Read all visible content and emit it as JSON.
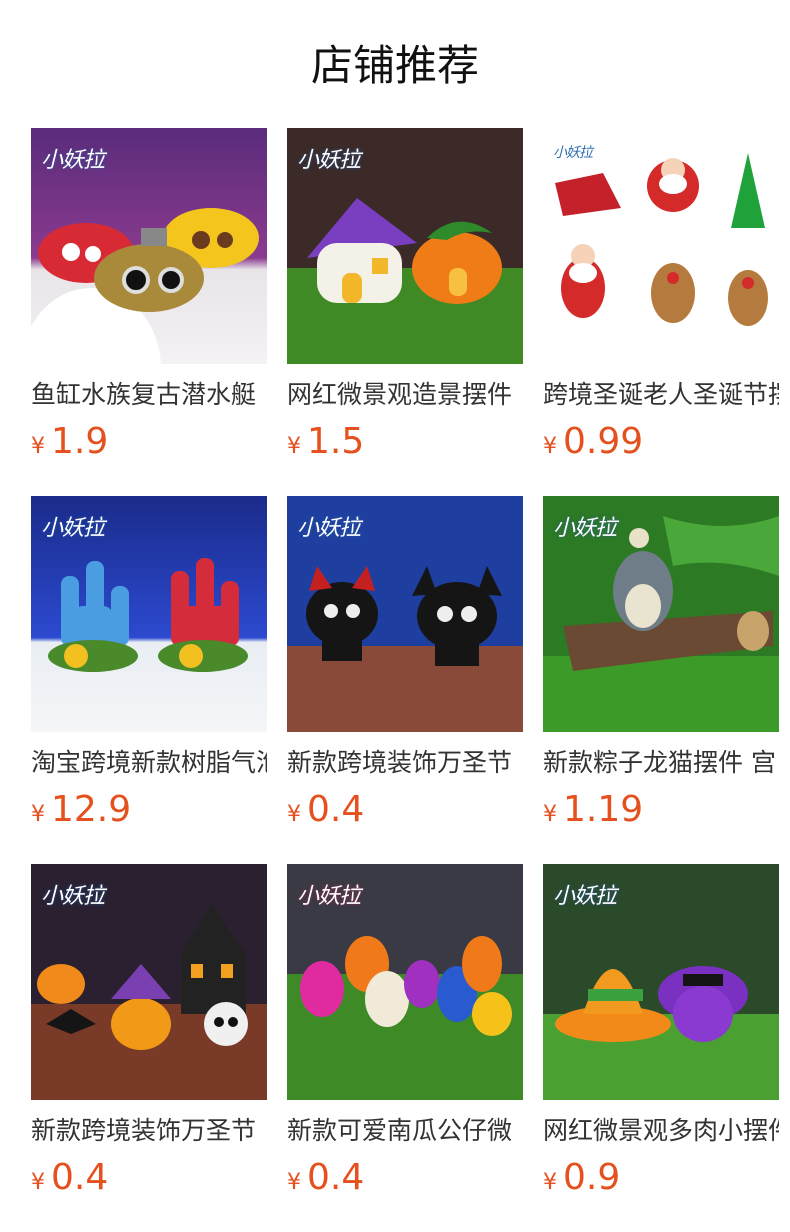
{
  "page": {
    "title": "店铺推荐"
  },
  "brand_logo_text": "小妖拉",
  "currency_symbol": "¥",
  "accent_color": "#e4501e",
  "products": [
    {
      "name": "鱼缸水族复古潜水艇",
      "price": "1.9"
    },
    {
      "name": "网红微景观造景摆件",
      "price": "1.5"
    },
    {
      "name": "跨境圣诞老人圣诞节摆",
      "price": "0.99"
    },
    {
      "name": "淘宝跨境新款树脂气泡",
      "price": "12.9"
    },
    {
      "name": "新款跨境装饰万圣节",
      "price": "0.4"
    },
    {
      "name": "新款粽子龙猫摆件 宫",
      "price": "1.19"
    },
    {
      "name": "新款跨境装饰万圣节",
      "price": "0.4"
    },
    {
      "name": "新款可爱南瓜公仔微",
      "price": "0.4"
    },
    {
      "name": "网红微景观多肉小摆件",
      "price": "0.9"
    }
  ]
}
